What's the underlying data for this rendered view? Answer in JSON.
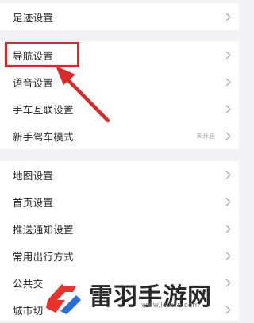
{
  "settings": {
    "group1": [
      {
        "label": "足迹设置"
      }
    ],
    "group2": [
      {
        "label": "导航设置"
      },
      {
        "label": "语音设置"
      },
      {
        "label": "手车互联设置"
      },
      {
        "label": "新手驾车模式",
        "status": "未开启"
      }
    ],
    "group3": [
      {
        "label": "地图设置"
      },
      {
        "label": "首页设置"
      },
      {
        "label": "推送通知设置"
      },
      {
        "label": "常用出行方式"
      },
      {
        "label": "公共交"
      },
      {
        "label": "城市切"
      }
    ]
  },
  "watermark": {
    "name": "雷羽手游网",
    "url": "www.leiucn.com"
  },
  "colors": {
    "highlight": "#e0252a",
    "background": "#f2f2f4"
  }
}
